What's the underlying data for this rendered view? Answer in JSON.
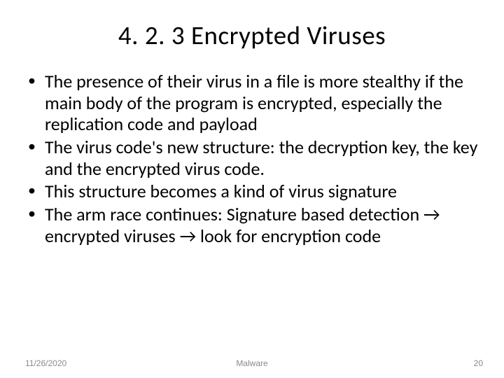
{
  "title": "4. 2. 3 Encrypted Viruses",
  "bullets": [
    "The presence of their virus in a file is more stealthy if the main body of the program is encrypted, especially the replication code and payload",
    "The virus code's  new structure: the decryption key, the key and the encrypted virus code.",
    "This structure becomes a kind of virus signature",
    "The arm race continues: Signature based detection → encrypted viruses → look for encryption code"
  ],
  "footer": {
    "date": "11/26/2020",
    "center": "Malware",
    "page": "20"
  }
}
